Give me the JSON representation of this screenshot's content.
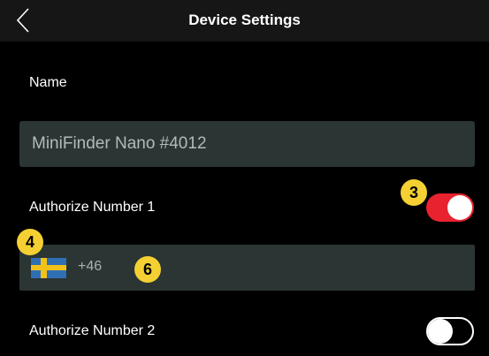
{
  "header": {
    "title": "Device Settings",
    "back_icon": "chevron-left-icon"
  },
  "name_section": {
    "label": "Name",
    "value": "MiniFinder Nano #4012"
  },
  "authorize_1": {
    "label": "Authorize Number 1",
    "enabled": true,
    "country_flag": "sweden-flag-icon",
    "country_code": "+46",
    "phone_number": ""
  },
  "authorize_2": {
    "label": "Authorize Number 2",
    "enabled": false
  },
  "callouts": {
    "toggle_marker": "3",
    "flag_marker": "4",
    "number_marker": "6"
  },
  "colors": {
    "toggle_on": "#e8232f",
    "field_bg": "#2b3534",
    "callout_bg": "#f4d033",
    "flag_blue": "#2f6fb4",
    "flag_yellow": "#f2c21b"
  }
}
